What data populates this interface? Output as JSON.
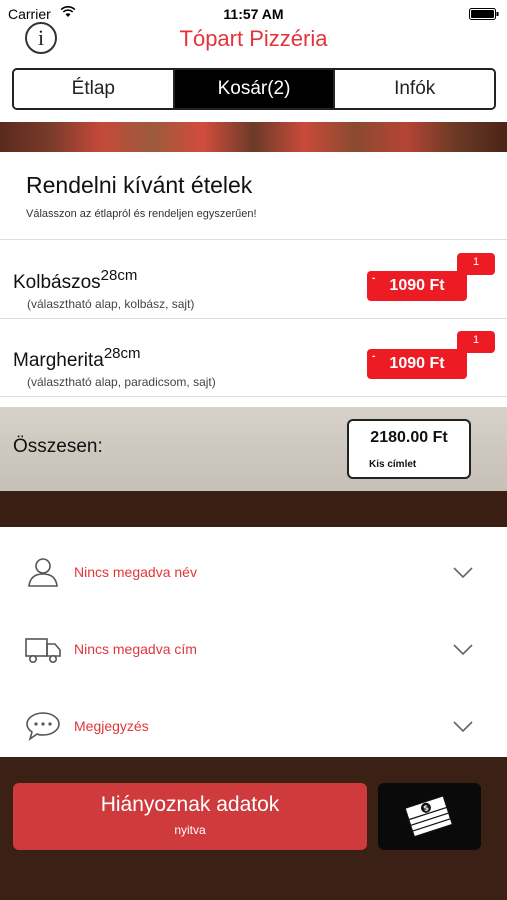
{
  "status_bar": {
    "carrier": "Carrier",
    "time": "11:57 AM"
  },
  "header": {
    "title": "Tópart Pizzéria",
    "info_label": "i"
  },
  "tabs": [
    {
      "label": "Étlap",
      "active": false
    },
    {
      "label": "Kosár(2)",
      "active": true
    },
    {
      "label": "Infók",
      "active": false
    }
  ],
  "order": {
    "title": "Rendelni kívánt ételek",
    "subtitle": "Válasszon az étlapról és rendeljen egyszerűen!",
    "items": [
      {
        "name": "Kolbászos",
        "size": "28cm",
        "description": "(választható alap, kolbász, sajt)",
        "price": "1090 Ft",
        "quantity": "1",
        "price_minus": "-"
      },
      {
        "name": "Margherita",
        "size": "28cm",
        "description": "(választható alap, paradicsom, sajt)",
        "price": "1090 Ft",
        "quantity": "1",
        "price_minus": "-"
      }
    ]
  },
  "total": {
    "label": "Összesen:",
    "amount": "2180.00 Ft",
    "note": "Kis címlet"
  },
  "form": {
    "name_placeholder": "Nincs megadva név",
    "address_placeholder": "Nincs megadva cím",
    "comment_label": "Megjegyzés"
  },
  "footer": {
    "missing_title": "Hiányoznak adatok",
    "missing_sub": "nyitva"
  },
  "colors": {
    "accent": "#e2353a",
    "price_red": "#ed1c24",
    "footer_bg": "#3b2015",
    "button_red": "#cf3a3c"
  },
  "icons": [
    "wifi-icon",
    "battery-icon",
    "info-icon",
    "person-icon",
    "truck-icon",
    "speech-bubble-icon",
    "chevron-down-icon",
    "money-stack-icon"
  ]
}
